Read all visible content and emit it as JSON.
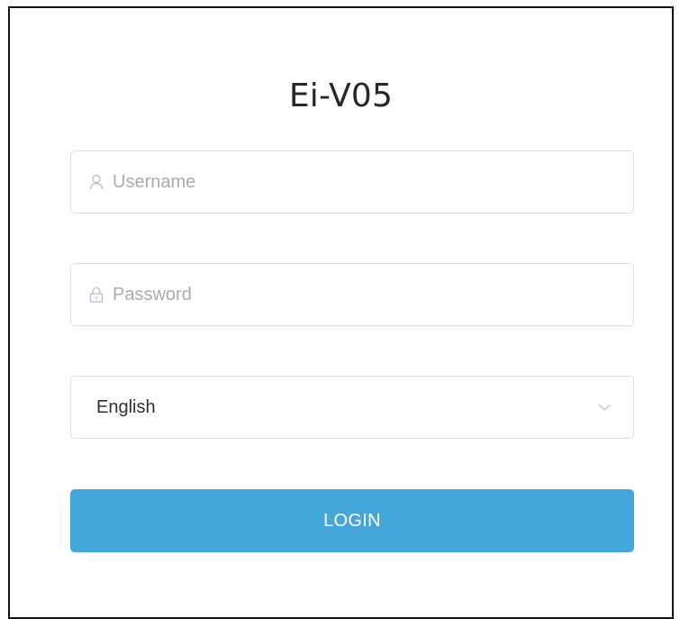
{
  "app": {
    "title": "Ei-V05"
  },
  "form": {
    "username": {
      "placeholder": "Username",
      "value": "",
      "icon": "user-icon"
    },
    "password": {
      "placeholder": "Password",
      "value": "",
      "icon": "lock-icon"
    },
    "language": {
      "selected": "English",
      "icon": "chevron-down-icon"
    },
    "login_label": "LOGIN"
  },
  "colors": {
    "primary": "#45a6dc",
    "border": "#dcdfe6",
    "placeholder": "#a8abb2",
    "text": "#303133"
  }
}
